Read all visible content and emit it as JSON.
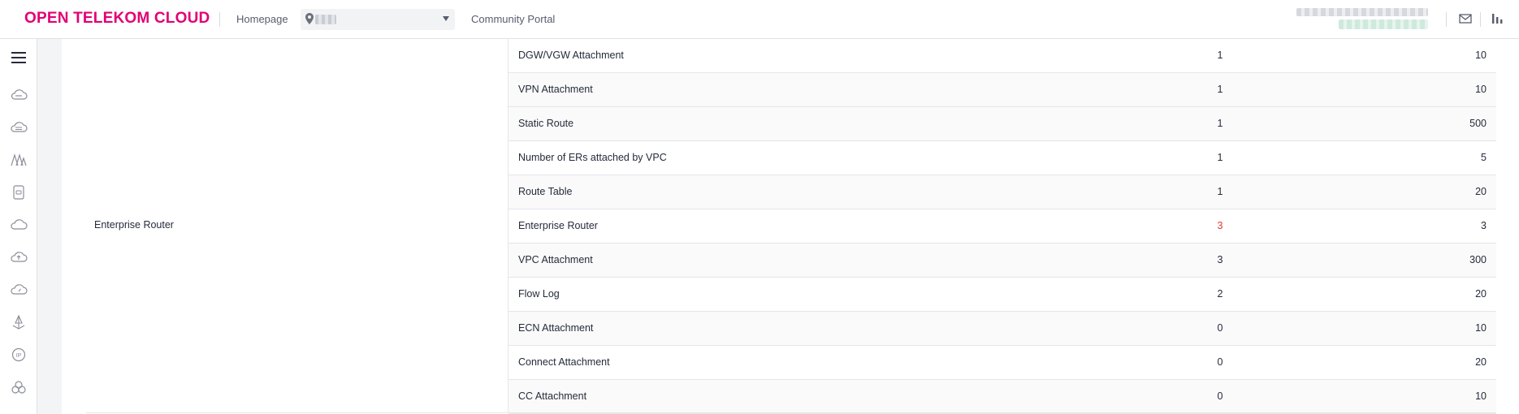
{
  "header": {
    "brand": "OPEN TELEKOM CLOUD",
    "homepage_label": "Homepage",
    "community_label": "Community Portal",
    "region_icon": "location-pin-icon",
    "mail_icon": "mail-icon",
    "chart_icon": "bar-chart-icon",
    "brand_color": "#e20074"
  },
  "sidebar": {
    "menu_icon": "hamburger-menu-icon",
    "icons": [
      "cloud-server-icon",
      "network-cloud-icon",
      "mountain-icon",
      "database-icon",
      "cloud-icon",
      "cloud-upload-icon",
      "cloud-gauge-icon",
      "anchor-icon",
      "ip-icon",
      "cluster-icon"
    ]
  },
  "quota_table": {
    "group_label": "Enterprise Router",
    "rows": [
      {
        "name": "DGW/VGW Attachment",
        "used": "1",
        "quota": "10",
        "warn": false
      },
      {
        "name": "VPN Attachment",
        "used": "1",
        "quota": "10",
        "warn": false
      },
      {
        "name": "Static Route",
        "used": "1",
        "quota": "500",
        "warn": false
      },
      {
        "name": "Number of ERs attached by VPC",
        "used": "1",
        "quota": "5",
        "warn": false
      },
      {
        "name": "Route Table",
        "used": "1",
        "quota": "20",
        "warn": false
      },
      {
        "name": "Enterprise Router",
        "used": "3",
        "quota": "3",
        "warn": true
      },
      {
        "name": "VPC Attachment",
        "used": "3",
        "quota": "300",
        "warn": false
      },
      {
        "name": "Flow Log",
        "used": "2",
        "quota": "20",
        "warn": false
      },
      {
        "name": "ECN Attachment",
        "used": "0",
        "quota": "10",
        "warn": false
      },
      {
        "name": "Connect Attachment",
        "used": "0",
        "quota": "20",
        "warn": false
      },
      {
        "name": "CC Attachment",
        "used": "0",
        "quota": "10",
        "warn": false
      }
    ],
    "warn_color": "#e53935"
  }
}
